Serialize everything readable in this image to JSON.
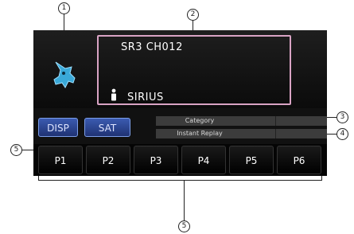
{
  "callouts": [
    "1",
    "2",
    "3",
    "4",
    "5",
    "5"
  ],
  "channel": "SR3 CH012",
  "station": "SIRIUS",
  "buttons": {
    "disp": "DISP",
    "sat": "SAT"
  },
  "info": {
    "category": "Category",
    "instant_replay": "Instant Replay"
  },
  "presets": [
    "P1",
    "P2",
    "P3",
    "P4",
    "P5",
    "P6"
  ],
  "icons": {
    "logo": "sirius-dog-logo",
    "artist": "person-icon"
  },
  "colors": {
    "accent_box": "#d9a3c4",
    "button": "#3b5bb1",
    "logo": "#3aa9d8"
  }
}
